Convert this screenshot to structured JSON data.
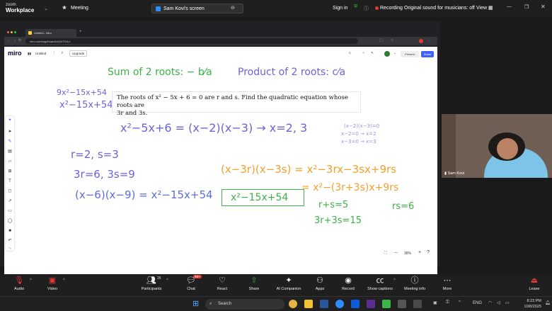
{
  "zoom": {
    "brand_line1": "zoom",
    "brand_line2": "Workplace",
    "meeting_label": "Meeting",
    "screen_share_label": "Sam Kovi's screen",
    "sign_in": "Sign in",
    "recording": "Recording",
    "original_sound": "Original sound for musicians: off",
    "view": "View"
  },
  "browser": {
    "tab_title": "Untitled - Miro",
    "url": "miro.com/app/board/uXjVITO4=/"
  },
  "miro": {
    "logo": "miro",
    "board_name": "Untitled",
    "upgrade": "Upgrade",
    "present": "Present",
    "share": "Share",
    "zoom_level": "36%"
  },
  "board": {
    "sum_roots": "Sum of 2 roots: − b⁄a",
    "product_roots": "Product of 2 roots: c⁄a",
    "left_eq1": "9x²−15x+54",
    "left_eq2": "x²−15x+54",
    "problem_line1": "The roots of x² − 5x + 6 = 0 are r and s. Find the quadratic equation whose roots are",
    "problem_line2": "3r and 3s.",
    "factor_line": "x²−5x+6 = (x−2)(x−3)  →  x=2, 3",
    "side_note1": "(x−2)(x−3)=0",
    "side_note2": "x−2=0 → x=2",
    "side_note3": "x−3=0 → x=3",
    "rs_values": "r=2, s=3",
    "triple_values": "3r=6, 3s=9",
    "expand_blue": "(x−6)(x−9) = x²−15x+54",
    "expand_orange1": "(x−3r)(x−3s) = x²−3rx−3sx+9rs",
    "expand_orange2": "= x²−(3r+3s)x+9rs",
    "answer": "x²−15x+54",
    "sum_rs": "r+s=5",
    "prod_rs": "rs=6",
    "sum_3rs": "3r+3s=15"
  },
  "participant": {
    "name": "Sam Kovi"
  },
  "controls": [
    {
      "label": "Audio",
      "icon": "mic-off-icon"
    },
    {
      "label": "Video",
      "icon": "video-off-icon"
    },
    {
      "label": "Participants",
      "icon": "participants-icon",
      "count": "26"
    },
    {
      "label": "Chat",
      "icon": "chat-icon",
      "badge": "99+"
    },
    {
      "label": "React",
      "icon": "heart-icon"
    },
    {
      "label": "Share",
      "icon": "share-icon"
    },
    {
      "label": "AI Companion",
      "icon": "sparkle-icon"
    },
    {
      "label": "Apps",
      "icon": "apps-icon"
    },
    {
      "label": "Record",
      "icon": "record-icon"
    },
    {
      "label": "Show captions",
      "icon": "captions-icon"
    },
    {
      "label": "Meeting info",
      "icon": "info-icon"
    },
    {
      "label": "More",
      "icon": "more-icon"
    },
    {
      "label": "Leave",
      "icon": "leave-icon"
    }
  ],
  "taskbar": {
    "search": "Search",
    "lang": "ENG",
    "time": "8:23 PM",
    "date": "10/8/2025"
  },
  "colors": {
    "green_ink": "#3cb24a",
    "purple_ink": "#6b63d9",
    "orange_ink": "#f5a02b",
    "miro_blue": "#4262ff",
    "recording_red": "#e53935"
  }
}
